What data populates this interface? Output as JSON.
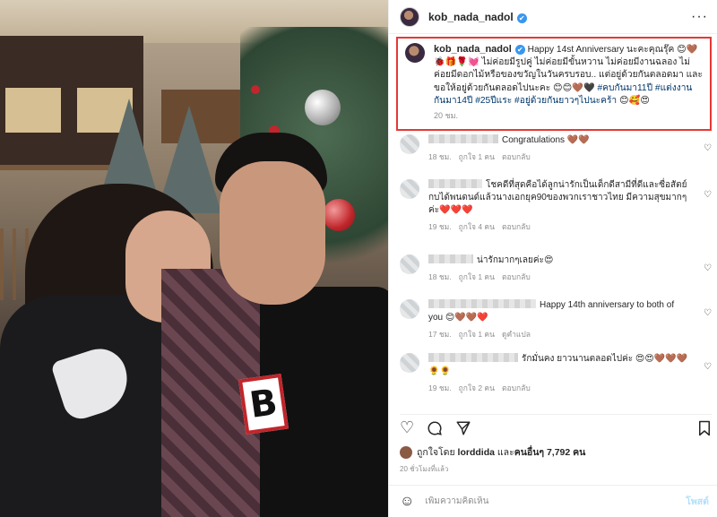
{
  "post": {
    "username": "kob_nada_nadol",
    "verified_mark": "✔"
  },
  "caption": {
    "username": "kob_nada_nadol",
    "line1": "Happy 14st Anniversary นะคะคุณรุ๊ค 😊🤎",
    "line2": "🐞🎁🌹💓 ไม่ค่อยมีรูปคู่ ไม่ค่อยมีขั้นหวาน ไม่ค่อยมีงานฉลอง ไม่ค่อยมีดอกไม้หรือของขวัญในวันครบรอบ.. แต่อยู่ด้วยกันตลอดมา และขอให้อยู่ด้วยกันตลอดไปนะคะ 😊😊🤎🖤",
    "tags": [
      "#คบกันมา11ปี",
      "#แต่งงานกันมา14ปี",
      "#25ปีแระ",
      "#อยู่ด้วยกันยาวๆไปนะคร้า"
    ],
    "tail": "😊🥰😍",
    "time": "20 ชม."
  },
  "comments": [
    {
      "text": "Congratulations 🤎🤎",
      "time": "18 ชม.",
      "likes": "ถูกใจ 1 คน",
      "reply": "ตอบกลับ",
      "blur_width": 78
    },
    {
      "text": "โชคดีที่สุดคือได้ลูกน่ารักเป็นเด็กดีสามีที่ดีและซื่อสัตย์กบได้พนดนด์แล้วนางเอกยุค90ของพวกเราชาวไทย มีความสุขมากๆค่ะ❤️❤️❤️",
      "time": "19 ชม.",
      "likes": "ถูกใจ 4 คน",
      "reply": "ตอบกลับ",
      "blur_width": 60
    },
    {
      "text": "น่ารักมากๆเลยค่ะ😍",
      "time": "18 ชม.",
      "likes": "ถูกใจ 1 คน",
      "reply": "ตอบกลับ",
      "blur_width": 50
    },
    {
      "text": "Happy 14th anniversary to both of you 😊🤎🤎❤️",
      "time": "17 ชม.",
      "likes": "ถูกใจ 1 คน",
      "reply": "ดูคำแปล",
      "blur_width": 120
    },
    {
      "text": "รักมั่นคง ยาวนานตลอดไปค่ะ 😍😍🤎🤎🤎🌻🌻",
      "time": "19 ชม.",
      "likes": "ถูกใจ 2 คน",
      "reply": "ตอบกลับ",
      "blur_width": 100
    }
  ],
  "likes": {
    "prefix": "ถูกใจโดย",
    "user": "lorddida",
    "and": "และ",
    "others": "คนอื่นๆ 7,792 คน"
  },
  "posted_ago": "20 ชั่วโมงที่แล้ว",
  "add_comment": {
    "placeholder": "เพิ่มความคิดเห็น",
    "post_label": "โพสต์"
  },
  "colors": {
    "highlight_border": "#e53935",
    "verified": "#3897f0",
    "hashtag": "#00376b",
    "post_button_disabled": "#b2dffc"
  }
}
